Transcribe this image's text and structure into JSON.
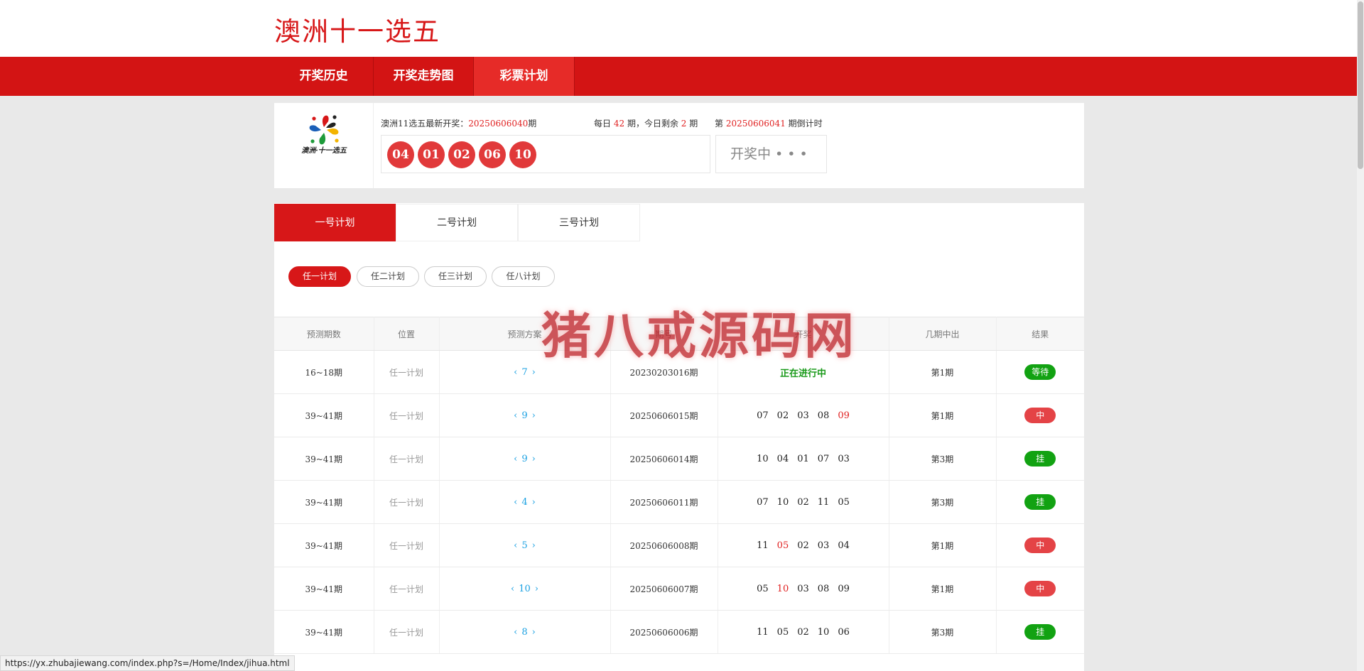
{
  "header": {
    "title": "澳洲十一选五"
  },
  "nav": {
    "items": [
      {
        "label": "开奖历史",
        "active": false
      },
      {
        "label": "开奖走势图",
        "active": false
      },
      {
        "label": "彩票计划",
        "active": true
      }
    ]
  },
  "draw": {
    "logo_caption": "澳洲·十一选五",
    "latest_prefix": "澳洲11选五最新开奖：",
    "latest_issue": "20250606040",
    "latest_suffix": "期",
    "balls": [
      "04",
      "01",
      "02",
      "06",
      "10"
    ],
    "daily_prefix": "每日",
    "daily_total": "42",
    "daily_mid": "期，今日剩余",
    "daily_remaining": "2",
    "daily_suffix": "期",
    "next_prefix": "第",
    "next_issue": "20250606041",
    "next_suffix": "期倒计时",
    "status": "开奖中 • • •"
  },
  "plan_tabs": [
    {
      "label": "一号计划",
      "active": true
    },
    {
      "label": "二号计划",
      "active": false
    },
    {
      "label": "三号计划",
      "active": false
    }
  ],
  "sub_tabs": [
    {
      "label": "任一计划",
      "active": true
    },
    {
      "label": "任二计划",
      "active": false
    },
    {
      "label": "任三计划",
      "active": false
    },
    {
      "label": "任八计划",
      "active": false
    }
  ],
  "table": {
    "headers": [
      "预测期数",
      "位置",
      "预测方案",
      "期号",
      "开奖",
      "几期中出",
      "结果"
    ],
    "rows": [
      {
        "range": "16~18期",
        "position": "任一计划",
        "prediction": "7",
        "issue": "20230203016期",
        "numbers": [],
        "status_text": "正在进行中",
        "hit_index": -1,
        "period": "第1期",
        "result": "等待",
        "result_color": "#12a212"
      },
      {
        "range": "39~41期",
        "position": "任一计划",
        "prediction": "9",
        "issue": "20250606015期",
        "numbers": [
          "07",
          "02",
          "03",
          "08",
          "09"
        ],
        "hit_index": 4,
        "period": "第1期",
        "result": "中",
        "result_color": "#e44346"
      },
      {
        "range": "39~41期",
        "position": "任一计划",
        "prediction": "9",
        "issue": "20250606014期",
        "numbers": [
          "10",
          "04",
          "01",
          "07",
          "03"
        ],
        "hit_index": -1,
        "period": "第3期",
        "result": "挂",
        "result_color": "#12a212"
      },
      {
        "range": "39~41期",
        "position": "任一计划",
        "prediction": "4",
        "issue": "20250606011期",
        "numbers": [
          "07",
          "10",
          "02",
          "11",
          "05"
        ],
        "hit_index": -1,
        "period": "第3期",
        "result": "挂",
        "result_color": "#12a212"
      },
      {
        "range": "39~41期",
        "position": "任一计划",
        "prediction": "5",
        "issue": "20250606008期",
        "numbers": [
          "11",
          "05",
          "02",
          "03",
          "04"
        ],
        "hit_index": 1,
        "period": "第1期",
        "result": "中",
        "result_color": "#e44346"
      },
      {
        "range": "39~41期",
        "position": "任一计划",
        "prediction": "10",
        "issue": "20250606007期",
        "numbers": [
          "05",
          "10",
          "03",
          "08",
          "09"
        ],
        "hit_index": 1,
        "period": "第1期",
        "result": "中",
        "result_color": "#e44346"
      },
      {
        "range": "39~41期",
        "position": "任一计划",
        "prediction": "8",
        "issue": "20250606006期",
        "numbers": [
          "11",
          "05",
          "02",
          "10",
          "06"
        ],
        "hit_index": -1,
        "period": "第3期",
        "result": "挂",
        "result_color": "#12a212"
      }
    ]
  },
  "watermark": "猪八戒源码网",
  "status_bar": {
    "url": "https://yx.zhubajiewang.com/index.php?s=/Home/Index/jihua.html"
  },
  "colors": {
    "brand_red": "#d31414",
    "ball_red": "#e1393a",
    "win_red": "#e44346",
    "lose_green": "#12a212",
    "prediction_blue": "#1ba1e2"
  }
}
